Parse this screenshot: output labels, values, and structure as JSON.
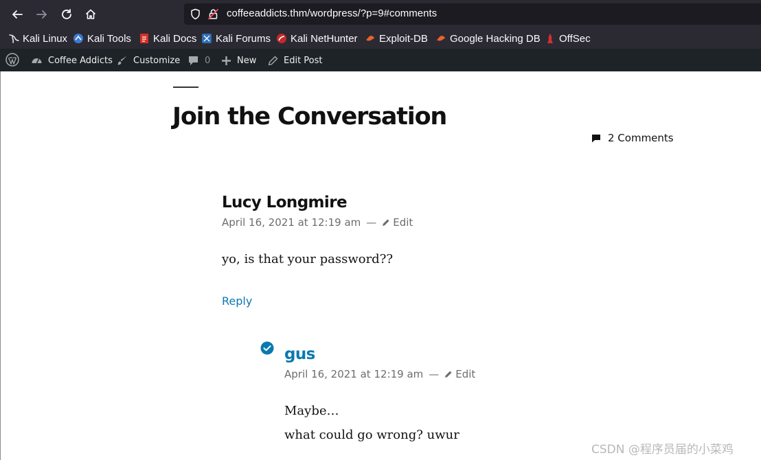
{
  "browser": {
    "url": "coffeeaddicts.thm/wordpress/?p=9#comments",
    "bookmarks": [
      {
        "label": "Kali Linux",
        "icon": "kali-dragon-icon"
      },
      {
        "label": "Kali Tools",
        "icon": "kali-tools-icon"
      },
      {
        "label": "Kali Docs",
        "icon": "kali-docs-icon"
      },
      {
        "label": "Kali Forums",
        "icon": "kali-forums-icon"
      },
      {
        "label": "Kali NetHunter",
        "icon": "nethunter-icon"
      },
      {
        "label": "Exploit-DB",
        "icon": "exploitdb-icon"
      },
      {
        "label": "Google Hacking DB",
        "icon": "ghdb-icon"
      },
      {
        "label": "OffSec",
        "icon": "offsec-icon"
      }
    ]
  },
  "admin_bar": {
    "site_name": "Coffee Addicts",
    "customize": "Customize",
    "comments_count": "0",
    "new": "New",
    "edit_post": "Edit Post"
  },
  "main": {
    "heading": "Join the Conversation",
    "comments_count": "2 Comments",
    "comments": [
      {
        "author": "Lucy Longmire",
        "date": "April 16, 2021 at 12:19 am",
        "separator": "—",
        "edit": "Edit",
        "body": [
          "yo, is that your password??"
        ],
        "reply": "Reply"
      },
      {
        "author": "gus",
        "date": "April 16, 2021 at 12:19 am",
        "separator": "—",
        "edit": "Edit",
        "body": [
          "Maybe…",
          "what could go wrong? uwur"
        ]
      }
    ]
  },
  "watermark": "CSDN @程序员届的小菜鸡",
  "colors": {
    "browser_chrome": "#2b2a33",
    "admin_bar": "#1d2327",
    "link_blue": "#0a79b0",
    "verified_blue": "#0a79b0"
  }
}
